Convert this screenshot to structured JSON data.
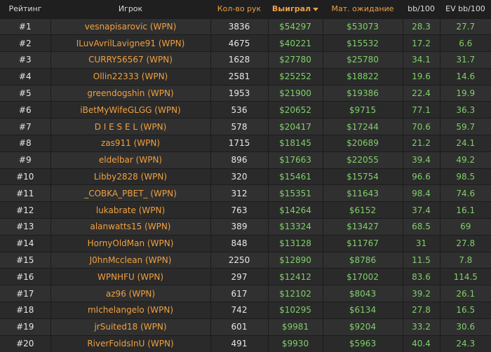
{
  "columns": {
    "rank": "Рейтинг",
    "player": "Игрок",
    "hands": "Кол-во рук",
    "won": "Выиграл",
    "ev": "Мат. ожидание",
    "bb": "bb/100",
    "evbb": "EV bb/100"
  },
  "sort": {
    "column": "won",
    "direction": "desc"
  },
  "rows": [
    {
      "rank": "#1",
      "player": "vesnapisarovic (WPN)",
      "hands": "3836",
      "won": "$54297",
      "ev": "$53073",
      "bb": "28.3",
      "evbb": "27.7"
    },
    {
      "rank": "#2",
      "player": "ILuvAvrilLavigne91 (WPN)",
      "hands": "4675",
      "won": "$40221",
      "ev": "$15532",
      "bb": "17.2",
      "evbb": "6.6"
    },
    {
      "rank": "#3",
      "player": "CURRY56567 (WPN)",
      "hands": "1628",
      "won": "$27780",
      "ev": "$25780",
      "bb": "34.1",
      "evbb": "31.7"
    },
    {
      "rank": "#4",
      "player": "Ollin22333 (WPN)",
      "hands": "2581",
      "won": "$25252",
      "ev": "$18822",
      "bb": "19.6",
      "evbb": "14.6"
    },
    {
      "rank": "#5",
      "player": "greendogshin (WPN)",
      "hands": "1953",
      "won": "$21900",
      "ev": "$19386",
      "bb": "22.4",
      "evbb": "19.9"
    },
    {
      "rank": "#6",
      "player": "iBetMyWifeGLGG (WPN)",
      "hands": "536",
      "won": "$20652",
      "ev": "$9715",
      "bb": "77.1",
      "evbb": "36.3"
    },
    {
      "rank": "#7",
      "player": "D I E S E L (WPN)",
      "hands": "578",
      "won": "$20417",
      "ev": "$17244",
      "bb": "70.6",
      "evbb": "59.7"
    },
    {
      "rank": "#8",
      "player": "zas911 (WPN)",
      "hands": "1715",
      "won": "$18145",
      "ev": "$20689",
      "bb": "21.2",
      "evbb": "24.1"
    },
    {
      "rank": "#9",
      "player": "eldelbar (WPN)",
      "hands": "896",
      "won": "$17663",
      "ev": "$22055",
      "bb": "39.4",
      "evbb": "49.2"
    },
    {
      "rank": "#10",
      "player": "Libby2828 (WPN)",
      "hands": "320",
      "won": "$15461",
      "ev": "$15754",
      "bb": "96.6",
      "evbb": "98.5"
    },
    {
      "rank": "#11",
      "player": "_COBKA_PBET_ (WPN)",
      "hands": "312",
      "won": "$15351",
      "ev": "$11643",
      "bb": "98.4",
      "evbb": "74.6"
    },
    {
      "rank": "#12",
      "player": "lukabrate (WPN)",
      "hands": "763",
      "won": "$14264",
      "ev": "$6152",
      "bb": "37.4",
      "evbb": "16.1"
    },
    {
      "rank": "#13",
      "player": "alanwatts15 (WPN)",
      "hands": "389",
      "won": "$13324",
      "ev": "$13427",
      "bb": "68.5",
      "evbb": "69"
    },
    {
      "rank": "#14",
      "player": "HornyOldMan (WPN)",
      "hands": "848",
      "won": "$13128",
      "ev": "$11767",
      "bb": "31",
      "evbb": "27.8"
    },
    {
      "rank": "#15",
      "player": "J0hnMcclean (WPN)",
      "hands": "2250",
      "won": "$12890",
      "ev": "$8786",
      "bb": "11.5",
      "evbb": "7.8"
    },
    {
      "rank": "#16",
      "player": "WPNHFU (WPN)",
      "hands": "297",
      "won": "$12412",
      "ev": "$17002",
      "bb": "83.6",
      "evbb": "114.5"
    },
    {
      "rank": "#17",
      "player": "az96 (WPN)",
      "hands": "617",
      "won": "$12102",
      "ev": "$8043",
      "bb": "39.2",
      "evbb": "26.1"
    },
    {
      "rank": "#18",
      "player": "mIchelangelo (WPN)",
      "hands": "742",
      "won": "$10295",
      "ev": "$6134",
      "bb": "27.8",
      "evbb": "16.5"
    },
    {
      "rank": "#19",
      "player": "jrSuited18 (WPN)",
      "hands": "601",
      "won": "$9981",
      "ev": "$9204",
      "bb": "33.2",
      "evbb": "30.6"
    },
    {
      "rank": "#20",
      "player": "RiverFoldsInU (WPN)",
      "hands": "491",
      "won": "$9930",
      "ev": "$5963",
      "bb": "40.4",
      "evbb": "24.3"
    }
  ]
}
